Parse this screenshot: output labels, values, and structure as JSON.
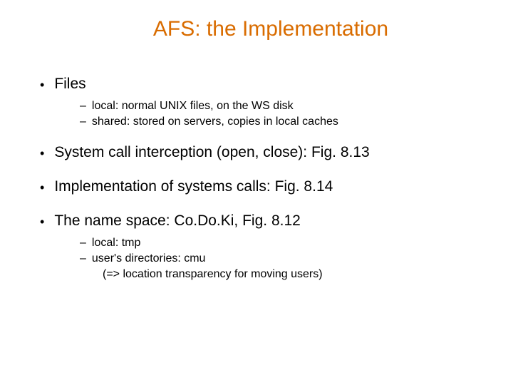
{
  "title": "AFS: the Implementation",
  "bullet1": {
    "label": "Files",
    "sub1": "local: normal UNIX files, on the WS disk",
    "sub2": "shared: stored on servers, copies in local caches"
  },
  "bullet2": {
    "label": "System call interception (open, close): Fig. 8.13"
  },
  "bullet3": {
    "label": "Implementation of systems calls: Fig. 8.14"
  },
  "bullet4": {
    "label": "The name space: Co.Do.Ki, Fig. 8.12",
    "sub1": "local: tmp",
    "sub2": "user's directories: cmu",
    "sub2a": "(=> location transparency for moving users)"
  }
}
